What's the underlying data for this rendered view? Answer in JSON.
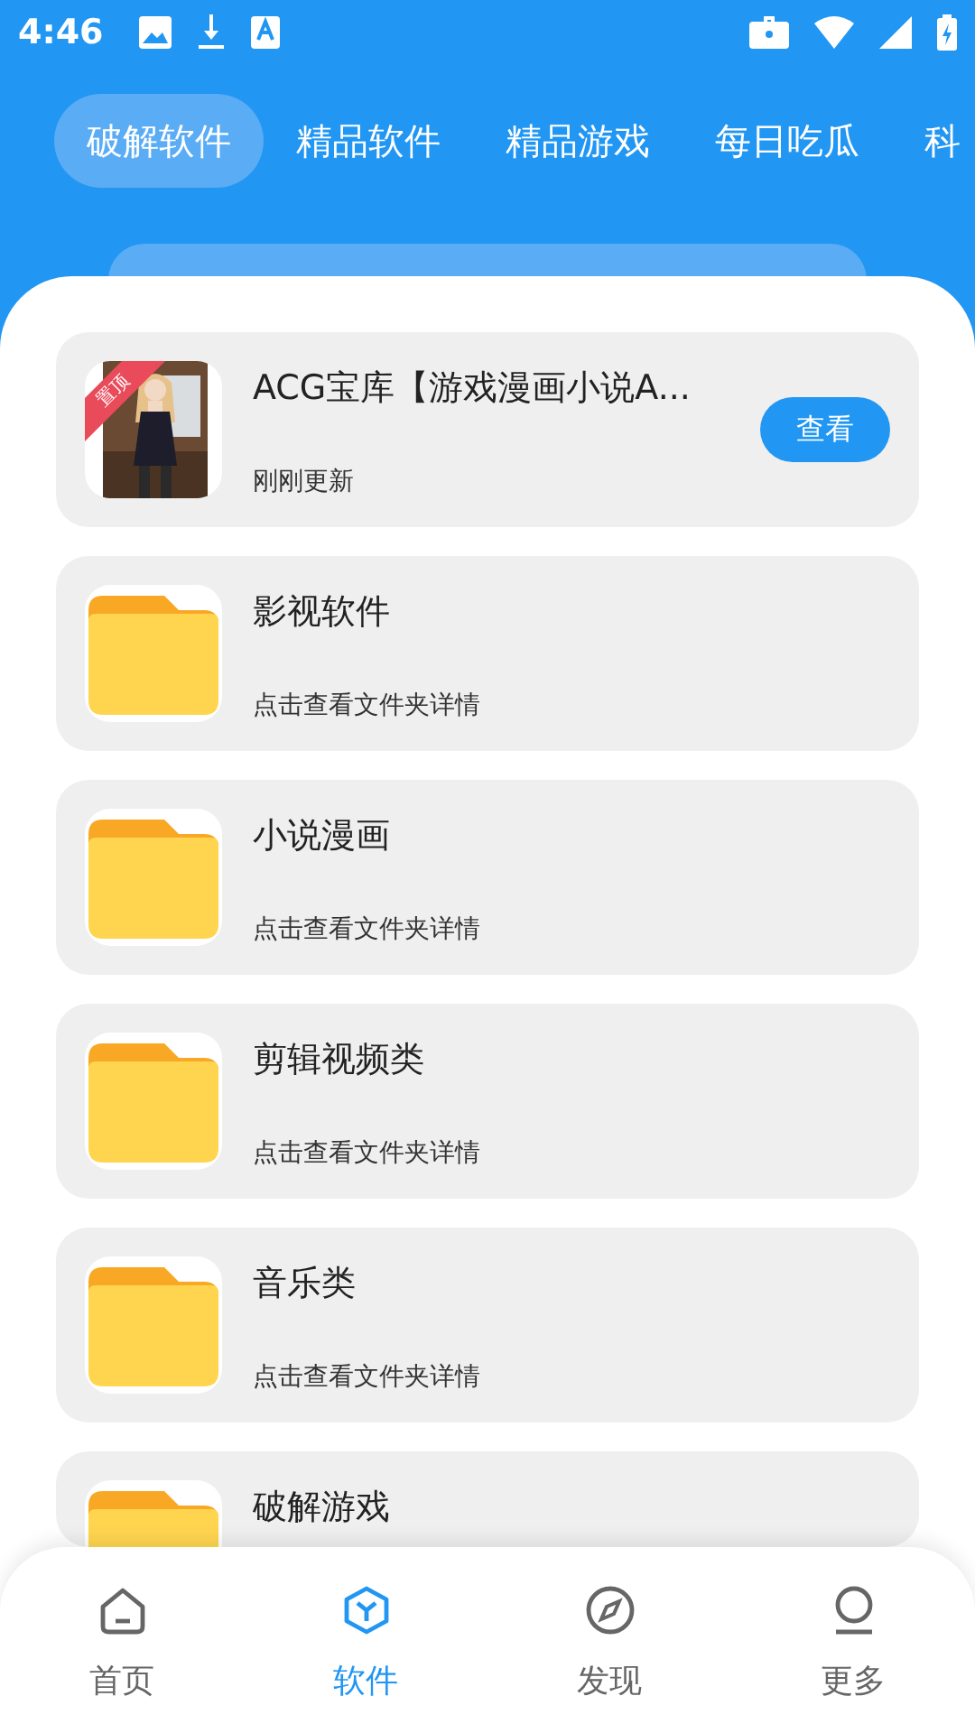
{
  "status_bar": {
    "time": "4:46"
  },
  "tabs": [
    {
      "label": "破解软件",
      "selected": true
    },
    {
      "label": "精品软件",
      "selected": false
    },
    {
      "label": "精品游戏",
      "selected": false
    },
    {
      "label": "每日吃瓜",
      "selected": false
    },
    {
      "label": "科",
      "selected": false
    }
  ],
  "items": [
    {
      "kind": "app",
      "title": "ACG宝库【游戏漫画小说A...",
      "subtitle": "刚刚更新",
      "badge": "置顶",
      "button": "查看"
    },
    {
      "kind": "folder",
      "title": "影视软件",
      "subtitle": "点击查看文件夹详情"
    },
    {
      "kind": "folder",
      "title": "小说漫画",
      "subtitle": "点击查看文件夹详情"
    },
    {
      "kind": "folder",
      "title": "剪辑视频类",
      "subtitle": "点击查看文件夹详情"
    },
    {
      "kind": "folder",
      "title": "音乐类",
      "subtitle": "点击查看文件夹详情"
    },
    {
      "kind": "folder",
      "title": "破解游戏"
    }
  ],
  "bottom_nav": [
    {
      "kind": "home",
      "label": "首页",
      "selected": false
    },
    {
      "kind": "cube",
      "label": "软件",
      "selected": true
    },
    {
      "kind": "compass",
      "label": "发现",
      "selected": false
    },
    {
      "kind": "person",
      "label": "更多",
      "selected": false
    }
  ]
}
